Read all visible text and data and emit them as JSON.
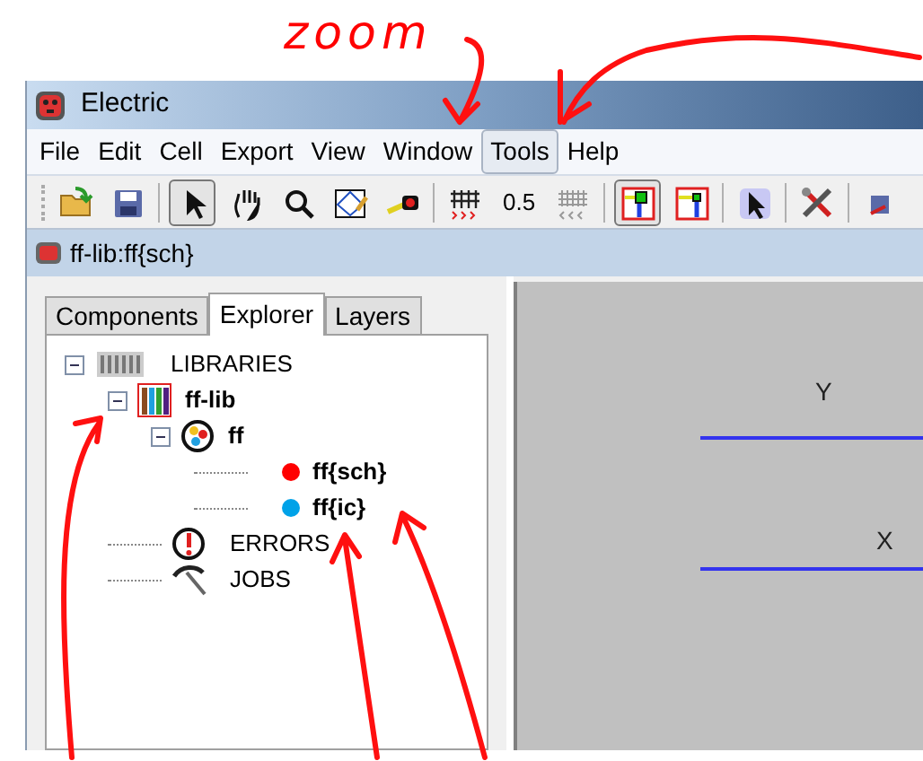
{
  "annotation": {
    "text": "zoom"
  },
  "window": {
    "title": "Electric"
  },
  "menu": [
    {
      "label": "File",
      "selected": false
    },
    {
      "label": "Edit",
      "selected": false
    },
    {
      "label": "Cell",
      "selected": false
    },
    {
      "label": "Export",
      "selected": false
    },
    {
      "label": "View",
      "selected": false
    },
    {
      "label": "Window",
      "selected": false
    },
    {
      "label": "Tools",
      "selected": true
    },
    {
      "label": "Help",
      "selected": false
    }
  ],
  "toolbar": [
    {
      "kind": "open",
      "selected": false
    },
    {
      "kind": "save",
      "selected": false
    },
    {
      "kind": "sep"
    },
    {
      "kind": "pointer",
      "selected": true
    },
    {
      "kind": "hand",
      "selected": false
    },
    {
      "kind": "zoom",
      "selected": false
    },
    {
      "kind": "outline",
      "selected": false
    },
    {
      "kind": "measure",
      "selected": false
    },
    {
      "kind": "sep"
    },
    {
      "kind": "grid-up",
      "selected": false
    },
    {
      "kind": "text",
      "label": "0.5"
    },
    {
      "kind": "grid-down",
      "selected": false
    },
    {
      "kind": "sep"
    },
    {
      "kind": "wire-a",
      "selected": true
    },
    {
      "kind": "wire-b",
      "selected": false
    },
    {
      "kind": "sep"
    },
    {
      "kind": "special-select",
      "selected": false
    },
    {
      "kind": "sep"
    },
    {
      "kind": "tools",
      "selected": false
    },
    {
      "kind": "sep"
    },
    {
      "kind": "partial",
      "selected": false
    }
  ],
  "document": {
    "title": "ff-lib:ff{sch}"
  },
  "tabs": [
    {
      "label": "Components",
      "selected": false
    },
    {
      "label": "Explorer",
      "selected": true
    },
    {
      "label": "Layers",
      "selected": false
    }
  ],
  "tree": [
    {
      "kind": "libraries",
      "label": "LIBRARIES",
      "expanded": true,
      "children": [
        {
          "kind": "library",
          "label": "ff-lib",
          "expanded": true,
          "children": [
            {
              "kind": "cell",
              "label": "ff",
              "expanded": true,
              "children": [
                {
                  "kind": "view",
                  "label": "ff{sch}",
                  "color": "#ff0000"
                },
                {
                  "kind": "view",
                  "label": "ff{ic}",
                  "color": "#00a2e8"
                }
              ]
            }
          ]
        },
        {
          "kind": "errors",
          "label": "ERRORS"
        },
        {
          "kind": "jobs",
          "label": "JOBS"
        }
      ]
    }
  ],
  "canvas": {
    "labels": [
      "Y",
      "X"
    ]
  }
}
